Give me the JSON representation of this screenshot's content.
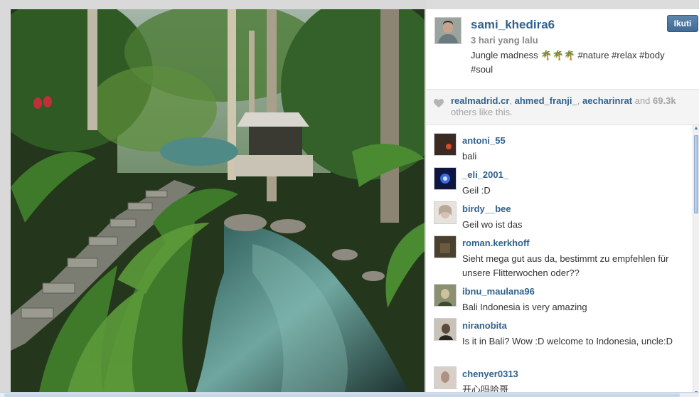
{
  "post": {
    "username": "sami_khedira6",
    "time_ago": "3 hari yang lalu",
    "caption": "Jungle madness 🌴🌴🌴 #nature #relax #body #soul",
    "follow_label": "Ikuti"
  },
  "likes": {
    "likers": [
      "realmadrid.cr",
      "ahmed_franji_",
      "aecharinrat"
    ],
    "and_label": "and",
    "count": "69.3k",
    "suffix": "others like this."
  },
  "comments": [
    {
      "user": "antoni_55",
      "text": "bali",
      "avatar_color": "#3a2a22"
    },
    {
      "user": "_eli_2001_",
      "text": "Geil :D",
      "avatar_color": "#1a2a8a"
    },
    {
      "user": "birdy__bee",
      "text": "Geil wo ist das",
      "avatar_color": "#d8d0c8"
    },
    {
      "user": "roman.kerkhoff",
      "text": "Sieht mega gut aus da, bestimmt zu empfehlen für unsere Flitterwochen oder??",
      "avatar_color": "#4a4030"
    },
    {
      "user": "ibnu_maulana96",
      "text": "Bali Indonesia is very amazing",
      "avatar_color": "#8a9070"
    },
    {
      "user": "niranobita",
      "text": "Is it in Bali? Wow :D welcome to Indonesia, uncle:D",
      "avatar_color": "#a09a90"
    },
    {
      "user": "chenyer0313",
      "text": "开心吗哈哥",
      "avatar_color": "#b0a098"
    }
  ],
  "colors": {
    "link": "#31628d",
    "button": "#4a76a3"
  }
}
